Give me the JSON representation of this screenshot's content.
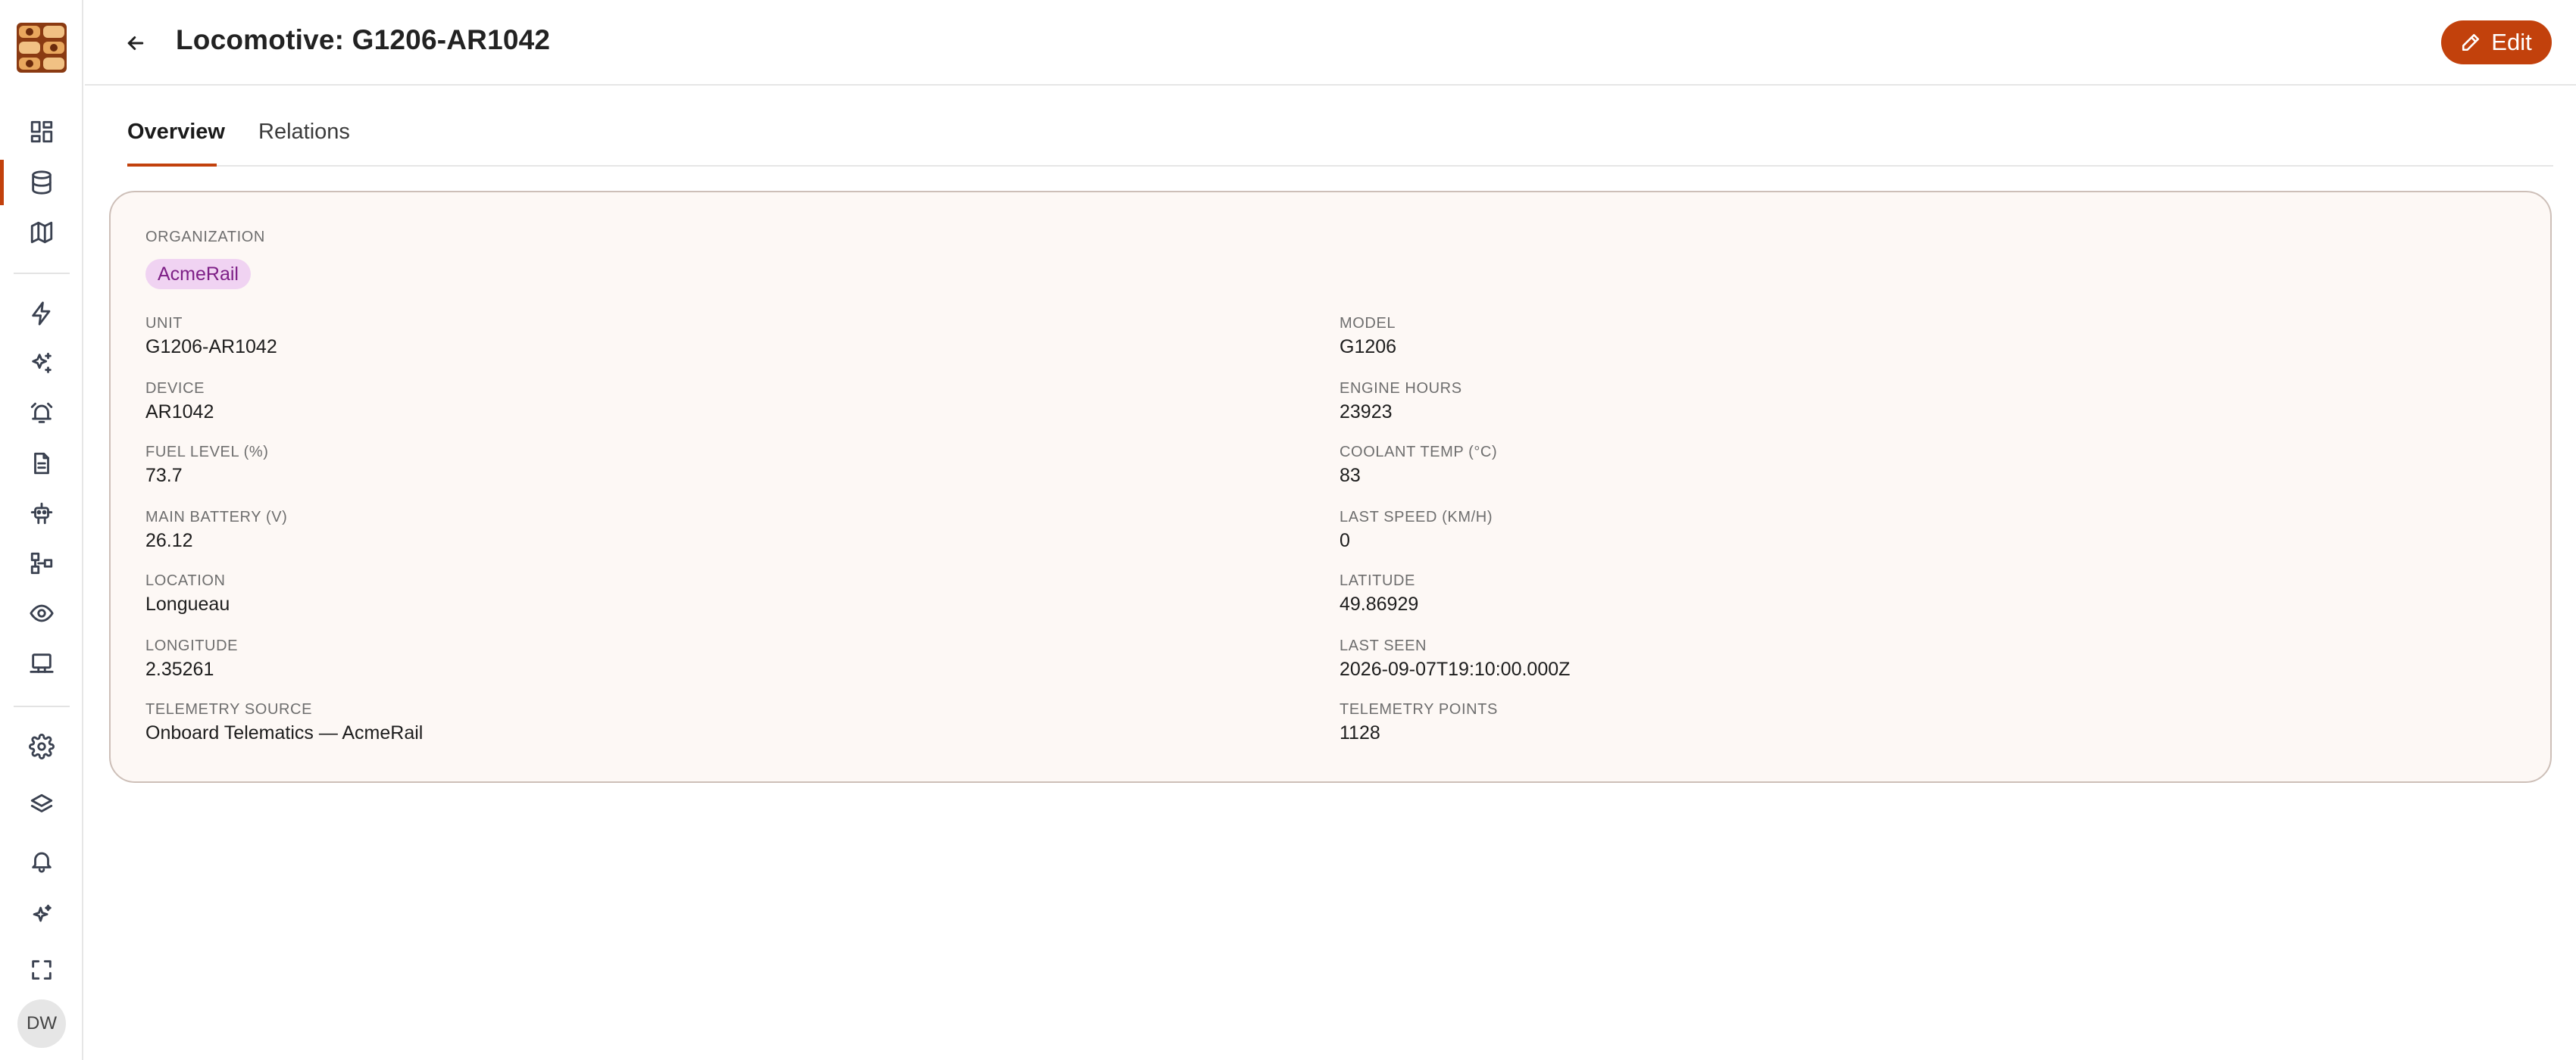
{
  "header": {
    "title": "Locomotive: G1206-AR1042",
    "edit_label": "Edit"
  },
  "tabs": [
    {
      "label": "Overview",
      "active": true
    },
    {
      "label": "Relations",
      "active": false
    }
  ],
  "sidebar": {
    "items": [
      {
        "icon": "dashboard-icon"
      },
      {
        "icon": "database-icon",
        "active": true
      },
      {
        "icon": "map-icon"
      },
      {
        "icon": "lightning-icon"
      },
      {
        "icon": "sparkles-icon"
      },
      {
        "icon": "alarm-icon"
      },
      {
        "icon": "document-icon"
      },
      {
        "icon": "robot-icon"
      },
      {
        "icon": "workflow-icon"
      },
      {
        "icon": "eye-icon"
      },
      {
        "icon": "terminal-icon"
      },
      {
        "icon": "gear-icon"
      },
      {
        "icon": "layers-icon"
      },
      {
        "icon": "bell-icon"
      },
      {
        "icon": "magic-icon"
      },
      {
        "icon": "fullscreen-icon"
      }
    ],
    "avatar_initials": "DW"
  },
  "organization": {
    "label": "ORGANIZATION",
    "value": "AcmeRail"
  },
  "fields": {
    "unit": {
      "label": "UNIT",
      "value": "G1206-AR1042"
    },
    "model": {
      "label": "MODEL",
      "value": "G1206"
    },
    "device": {
      "label": "DEVICE",
      "value": "AR1042"
    },
    "engine_hours": {
      "label": "ENGINE HOURS",
      "value": "23923"
    },
    "fuel_level": {
      "label": "FUEL LEVEL (%)",
      "value": "73.7"
    },
    "coolant_temp": {
      "label": "COOLANT TEMP (°C)",
      "value": "83"
    },
    "main_battery": {
      "label": "MAIN BATTERY (V)",
      "value": "26.12"
    },
    "last_speed": {
      "label": "LAST SPEED (KM/H)",
      "value": "0"
    },
    "location": {
      "label": "LOCATION",
      "value": "Longueau"
    },
    "latitude": {
      "label": "LATITUDE",
      "value": "49.86929"
    },
    "longitude": {
      "label": "LONGITUDE",
      "value": "2.35261"
    },
    "last_seen": {
      "label": "LAST SEEN",
      "value": "2026-09-07T19:10:00.000Z"
    },
    "telemetry_source": {
      "label": "TELEMETRY SOURCE",
      "value": "Onboard Telematics — AcmeRail"
    },
    "telemetry_points": {
      "label": "TELEMETRY POINTS",
      "value": "1128"
    }
  },
  "colors": {
    "accent": "#c2410c",
    "chip_bg": "#f0d3f2",
    "chip_text": "#7d1f86",
    "card_bg": "#fdf8f5"
  }
}
